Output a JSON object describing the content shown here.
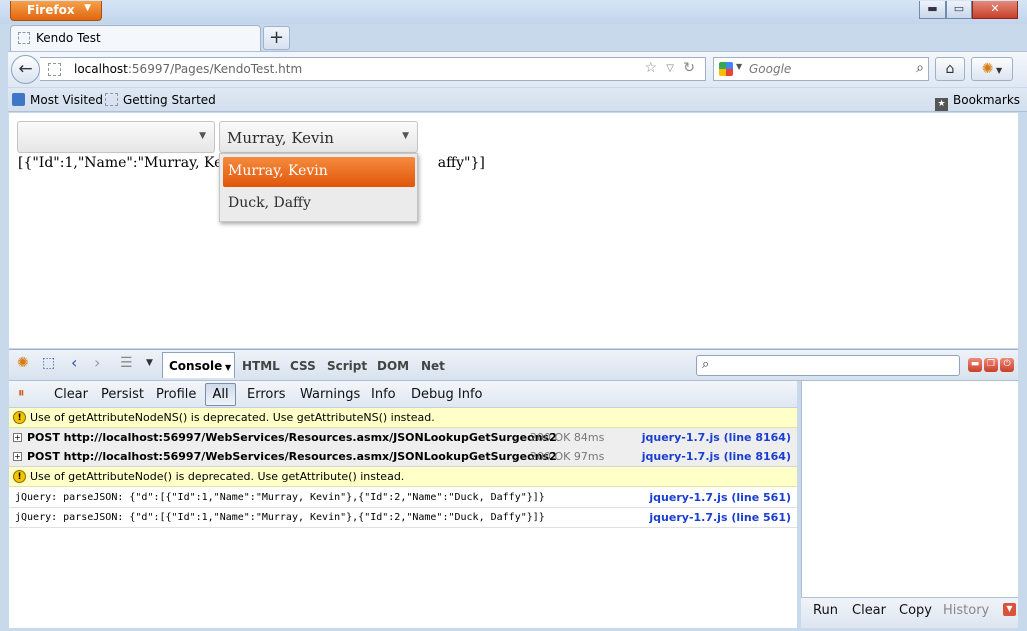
{
  "window": {
    "app_button": "Firefox",
    "min_glyph": "▬",
    "max_glyph": "▭",
    "close_glyph": "✕"
  },
  "tab": {
    "title": "Kendo Test",
    "new_tab_glyph": "+"
  },
  "nav": {
    "url_host": "localhost",
    "url_rest": ":56997/Pages/KendoTest.htm",
    "search_placeholder": "Google",
    "back_glyph": "←",
    "home_glyph": "⌂"
  },
  "bookmarks": {
    "most_visited": "Most Visited",
    "getting_started": "Getting Started",
    "bookmarks_menu": "Bookmarks"
  },
  "page": {
    "dropdown1_value": "",
    "dropdown2_value": "Murray, Kevin",
    "json_output_left": "[{\"Id\":1,\"Name\":\"Murray, Kevi",
    "json_output_right": "affy\"}]",
    "popup_items": [
      "Murray, Kevin",
      "Duck, Daffy"
    ]
  },
  "firebug": {
    "tabs": {
      "console": "Console",
      "html": "HTML",
      "css": "CSS",
      "script": "Script",
      "dom": "DOM",
      "net": "Net"
    },
    "filters": {
      "clear": "Clear",
      "persist": "Persist",
      "profile": "Profile",
      "all": "All",
      "errors": "Errors",
      "warnings": "Warnings",
      "info": "Info",
      "debug_info": "Debug Info"
    },
    "rows": [
      {
        "type": "warn",
        "text": "Use of getAttributeNodeNS() is deprecated. Use getAttributeNS() instead."
      },
      {
        "type": "post",
        "text": "POST http://localhost:56997/WebServices/Resources.asmx/JSONLookupGetSurgeons2",
        "status": "200 OK 84ms",
        "source": "jquery-1.7.js (line 8164)"
      },
      {
        "type": "post",
        "text": "POST http://localhost:56997/WebServices/Resources.asmx/JSONLookupGetSurgeons2",
        "status": "200 OK 97ms",
        "source": "jquery-1.7.js (line 8164)"
      },
      {
        "type": "warn",
        "text": "Use of getAttributeNode() is deprecated. Use getAttribute() instead."
      },
      {
        "type": "log",
        "text": "jQuery: parseJSON:  {\"d\":[{\"Id\":1,\"Name\":\"Murray, Kevin\"},{\"Id\":2,\"Name\":\"Duck, Daffy\"}]}",
        "source": "jquery-1.7.js (line 561)"
      },
      {
        "type": "log",
        "text": "jQuery: parseJSON:  {\"d\":[{\"Id\":1,\"Name\":\"Murray, Kevin\"},{\"Id\":2,\"Name\":\"Duck, Daffy\"}]}",
        "source": "jquery-1.7.js (line 561)"
      }
    ],
    "side_buttons": {
      "run": "Run",
      "clear": "Clear",
      "copy": "Copy",
      "history": "History"
    }
  }
}
